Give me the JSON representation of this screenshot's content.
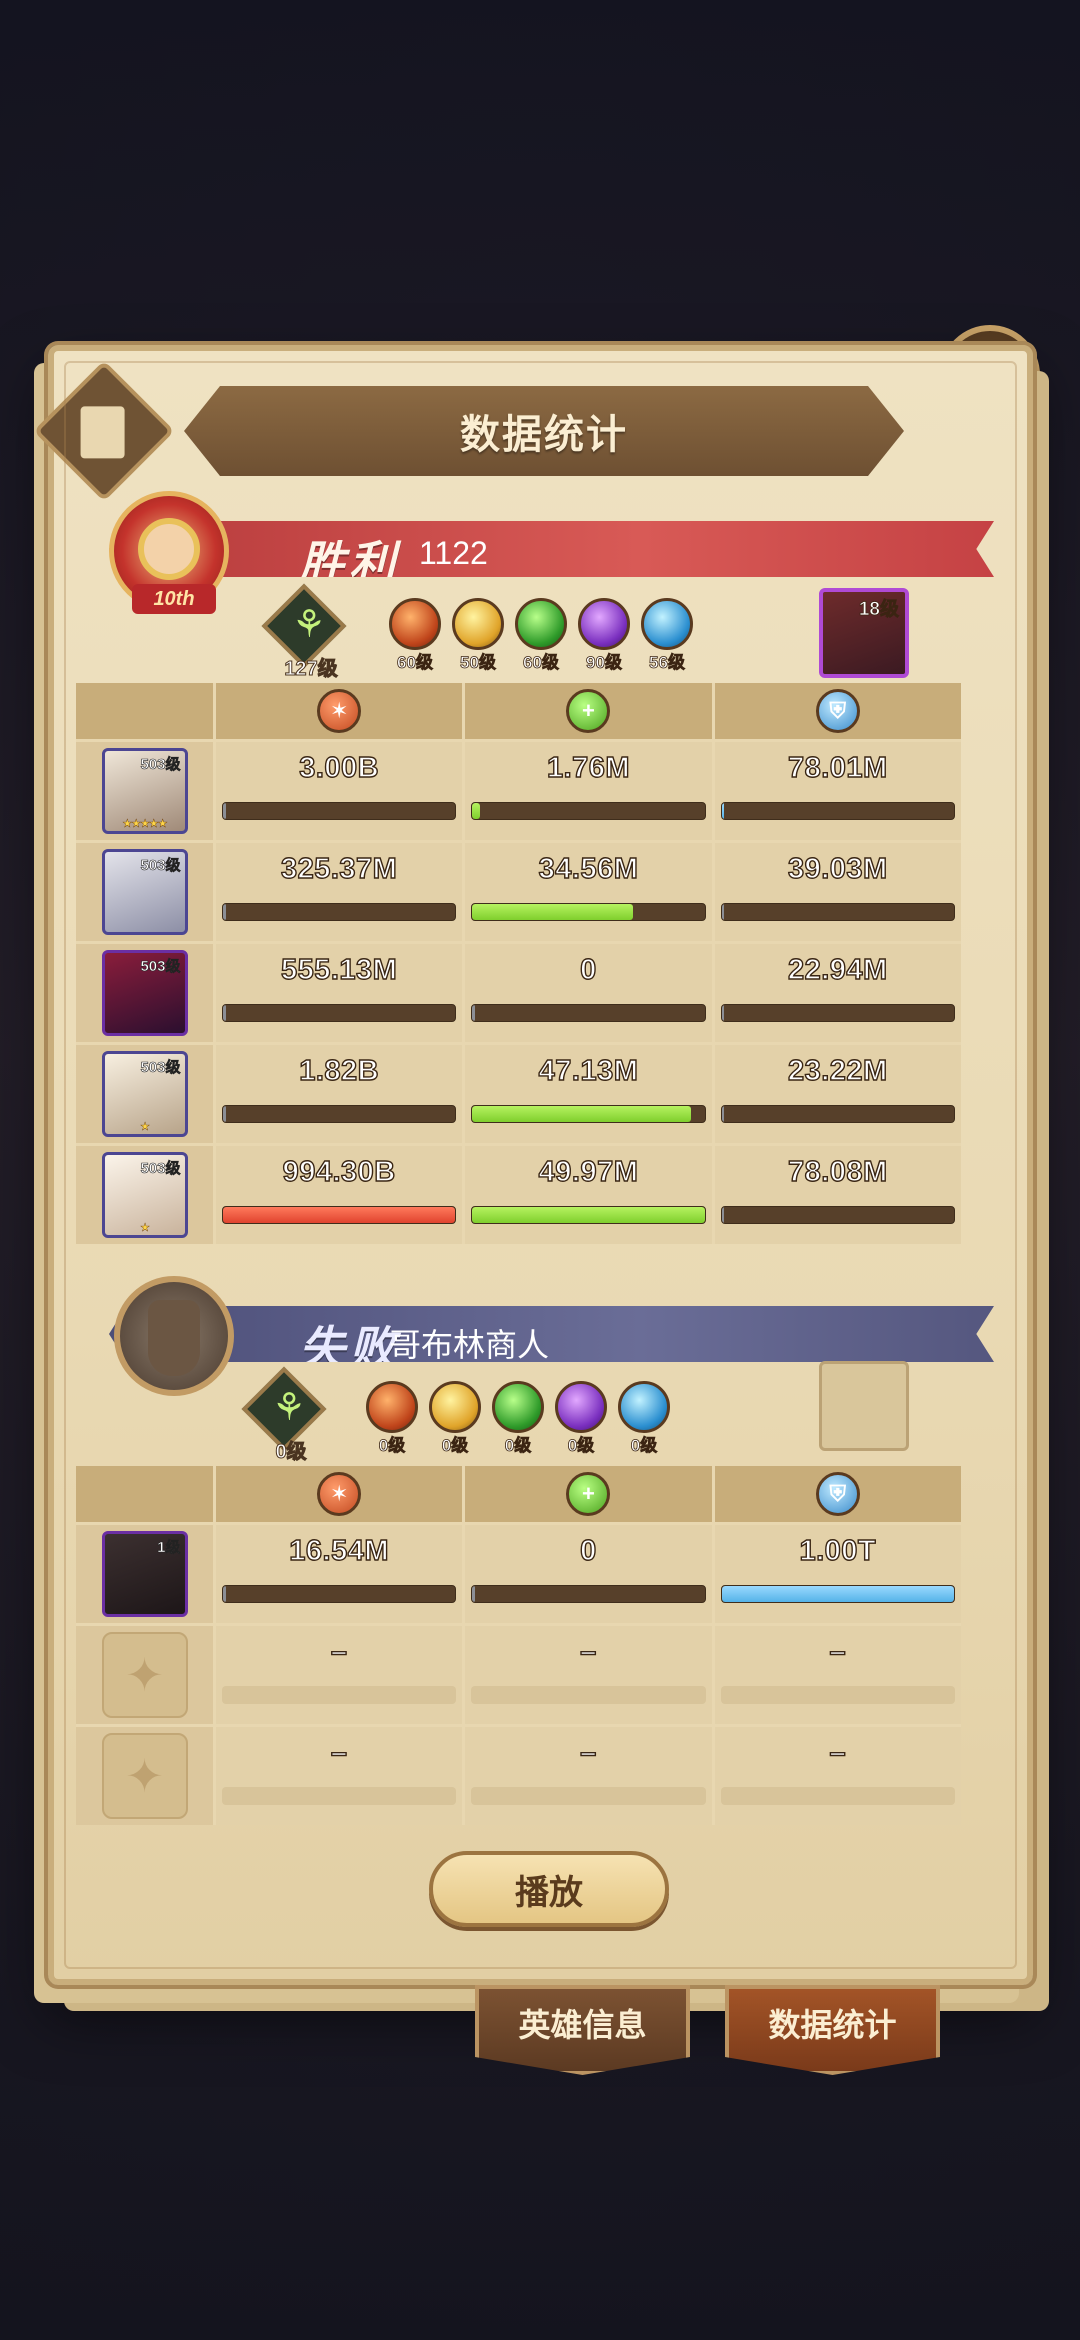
{
  "title": "数据统计",
  "close_icon": "✕",
  "win": {
    "label": "胜利",
    "score": "1122",
    "badge": "10th",
    "main_element_level": "127级",
    "element_levels": [
      "60级",
      "50级",
      "60级",
      "90级",
      "56级"
    ],
    "pet_level": "18级",
    "heroes": [
      {
        "level": "503级",
        "stars": "★★★★★",
        "damage": "3.00B",
        "heal": "1.76M",
        "defense": "78.01M",
        "damage_ratio": 0.0,
        "heal_ratio": 0.035,
        "defense_ratio": 0.01
      },
      {
        "level": "503级",
        "stars": "",
        "damage": "325.37M",
        "heal": "34.56M",
        "defense": "39.03M",
        "damage_ratio": 0.0,
        "heal_ratio": 0.69,
        "defense_ratio": 0.0
      },
      {
        "level": "503级",
        "stars": "",
        "damage": "555.13M",
        "heal": "0",
        "defense": "22.94M",
        "damage_ratio": 0.0,
        "heal_ratio": 0.0,
        "defense_ratio": 0.0
      },
      {
        "level": "503级",
        "stars": "★",
        "damage": "1.82B",
        "heal": "47.13M",
        "defense": "23.22M",
        "damage_ratio": 0.0,
        "heal_ratio": 0.94,
        "defense_ratio": 0.0
      },
      {
        "level": "503级",
        "stars": "★",
        "damage": "994.30B",
        "heal": "49.97M",
        "defense": "78.08M",
        "damage_ratio": 1.0,
        "heal_ratio": 1.0,
        "defense_ratio": 0.0
      }
    ]
  },
  "lose": {
    "label": "失败",
    "name": "哥布林商人",
    "main_element_level": "0级",
    "element_levels": [
      "0级",
      "0级",
      "0级",
      "0级",
      "0级"
    ],
    "heroes": [
      {
        "level": "1级",
        "damage": "16.54M",
        "heal": "0",
        "defense": "1.00T",
        "damage_ratio": 0.0,
        "heal_ratio": 0.0,
        "defense_ratio": 1.0
      },
      {
        "empty": true,
        "damage": "–",
        "heal": "–",
        "defense": "–"
      },
      {
        "empty": true,
        "damage": "–",
        "heal": "–",
        "defense": "–"
      }
    ]
  },
  "play_label": "播放",
  "tabs": [
    "英雄信息",
    "数据统计"
  ],
  "colors": {
    "damage_bar": "#e0432e",
    "heal_bar": "#7fcf2d",
    "defense_bar": "#55b3e8",
    "win_banner": "#c54244",
    "lose_banner": "#55577f"
  }
}
